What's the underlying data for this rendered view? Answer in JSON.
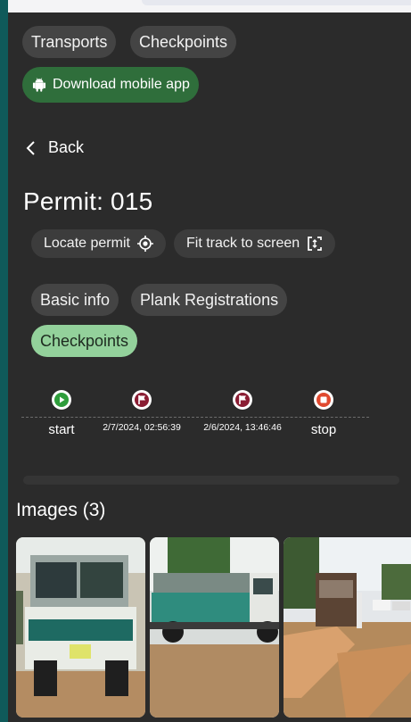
{
  "nav": {
    "transports": "Transports",
    "checkpoints": "Checkpoints",
    "download": "Download mobile app"
  },
  "back_label": "Back",
  "permit_title": "Permit: 015",
  "actions": {
    "locate": "Locate permit",
    "fit": "Fit track to screen"
  },
  "tabs": [
    "Basic info",
    "Plank Registrations",
    "Checkpoints"
  ],
  "active_tab": "Checkpoints",
  "checkpoints": [
    {
      "label": "start",
      "icon": "play-icon",
      "color": "#2e9d3b"
    },
    {
      "label": "2/7/2024, 02:56:39",
      "icon": "flag-icon",
      "color": "#8a1d33"
    },
    {
      "label": "2/6/2024, 13:46:46",
      "icon": "flag-icon",
      "color": "#8a1d33"
    },
    {
      "label": "stop",
      "icon": "stop-icon",
      "color": "#e0492f"
    }
  ],
  "images": {
    "title": "Images (3)"
  },
  "colors": {
    "accent_green": "#2f6e3b",
    "active_tab": "#93d19b",
    "background": "#2b2b2b"
  }
}
